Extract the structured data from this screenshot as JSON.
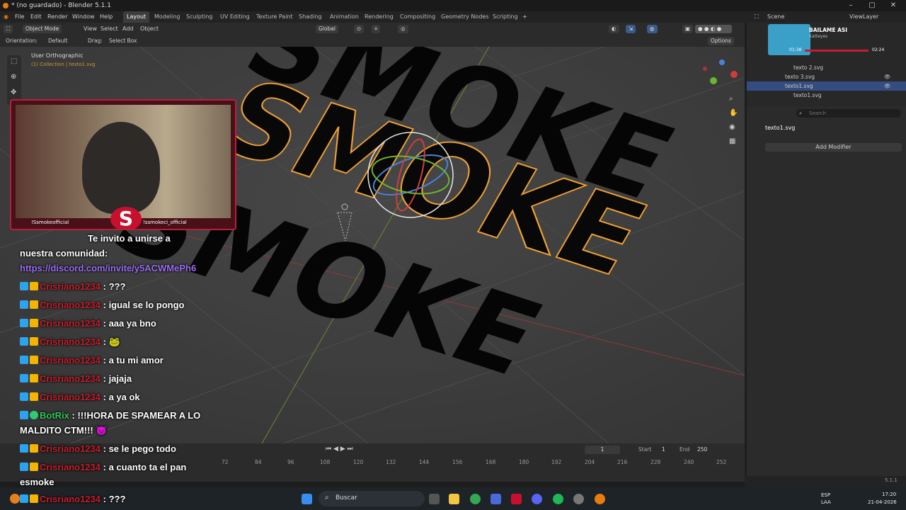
{
  "window": {
    "title": "* (no guardado) - Blender 5.1.1"
  },
  "menu": [
    "File",
    "Edit",
    "Render",
    "Window",
    "Help"
  ],
  "workspaces": [
    "Layout",
    "Modeling",
    "Sculpting",
    "UV Editing",
    "Texture Paint",
    "Shading",
    "Animation",
    "Rendering",
    "Compositing",
    "Geometry Nodes",
    "Scripting"
  ],
  "workspace_add": "+",
  "scene": {
    "label": "Scene",
    "view_layer": "ViewLayer"
  },
  "viewport_header": {
    "mode": "Object Mode",
    "view": "View",
    "select": "Select",
    "add": "Add",
    "object": "Object",
    "transform": "Global",
    "orientation_label": "Orientation:",
    "orientation_value": "Default",
    "drag_label": "Drag:",
    "drag_value": "Select Box",
    "options": "Options"
  },
  "viewport": {
    "view_name": "User Orthographic",
    "collection": "(1) Collection | texto1.svg",
    "text": "SMOKE"
  },
  "music": {
    "title": "BAILAME ASI",
    "artist": "Katteyes",
    "elapsed": "01:38",
    "total": "02:24"
  },
  "outliner": [
    {
      "label": "texto 2.svg",
      "selected": false
    },
    {
      "label": "texto 3.svg",
      "selected": false
    },
    {
      "label": "texto1.svg",
      "selected": true
    },
    {
      "label": "texto1.svg",
      "selected": false
    }
  ],
  "properties": {
    "search_placeholder": "Search",
    "object_name": "texto1.svg",
    "add_modifier": "Add Modifier"
  },
  "timeline": {
    "current_frame": "1",
    "start_label": "Start",
    "start": "1",
    "end_label": "End",
    "end": "250",
    "ticks": [
      "72",
      "84",
      "96",
      "108",
      "120",
      "132",
      "144",
      "156",
      "168",
      "180",
      "192",
      "204",
      "216",
      "228",
      "240",
      "252"
    ]
  },
  "version": "5.1.1",
  "webcam": {
    "handle_left": "!Ssmokeofficial",
    "handle_right": "!ssmokeci_official"
  },
  "chat": {
    "line0": "Te invito a unirse a",
    "line0b": "nuestra comunidad:",
    "link": "https://discord.com/invite/y5ACWMePh6",
    "messages": [
      {
        "user": "Crisriano1234",
        "text": ": ???"
      },
      {
        "user": "Crisriano1234",
        "text": ": igual se lo pongo"
      },
      {
        "user": "Crisriano1234",
        "text": ": aaa ya bno"
      },
      {
        "user": "Crisriano1234",
        "text": ": 🐸"
      },
      {
        "user": "Crisriano1234",
        "text": ": a tu mi amor"
      },
      {
        "user": "Crisriano1234",
        "text": ": jajaja"
      },
      {
        "user": "Crisriano1234",
        "text": ": a ya ok"
      }
    ],
    "bot_user": "BotRix",
    "bot_text": ": !!!HORA DE SPAMEAR A LO",
    "bot_text2": "MALDITO CTM!!! 😈",
    "more": [
      {
        "user": "Crisriano1234",
        "text": ": se le pego todo"
      },
      {
        "user": "Crisriano1234",
        "text": ": a cuanto ta el pan"
      }
    ],
    "tail": "esmoke",
    "last": {
      "user": "Crisriano1234",
      "text": ": ???"
    }
  },
  "taskbar": {
    "search": "Buscar",
    "lang": "ESP",
    "region": "LAA",
    "time": "17:20",
    "date": "21-04-2026"
  }
}
